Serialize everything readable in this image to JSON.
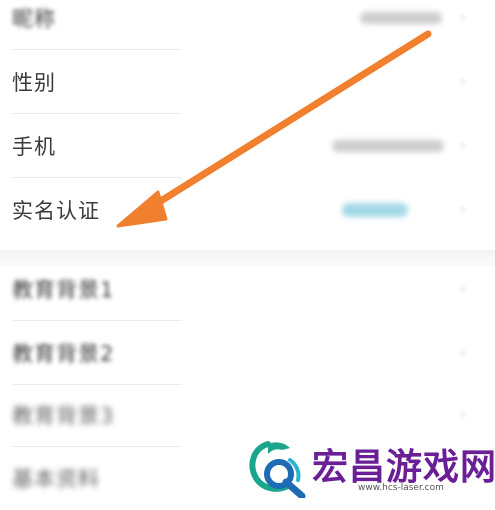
{
  "profile": {
    "rows": [
      {
        "label": "昵称"
      },
      {
        "label": "性别"
      },
      {
        "label": "手机"
      },
      {
        "label": "实名认证"
      }
    ]
  },
  "education": {
    "rows": [
      {
        "label": "教育背景1"
      },
      {
        "label": "教育背景2"
      },
      {
        "label": "教育背景3"
      }
    ],
    "last_label": "基本资料"
  },
  "watermark": {
    "title": "宏昌游戏网",
    "url": "www.hcs-laser.com"
  },
  "colors": {
    "arrow": "#f07f2e",
    "watermark_title": "#6a1f96",
    "logo_teal": "#1aa58c",
    "logo_blue": "#1d6ab5"
  }
}
